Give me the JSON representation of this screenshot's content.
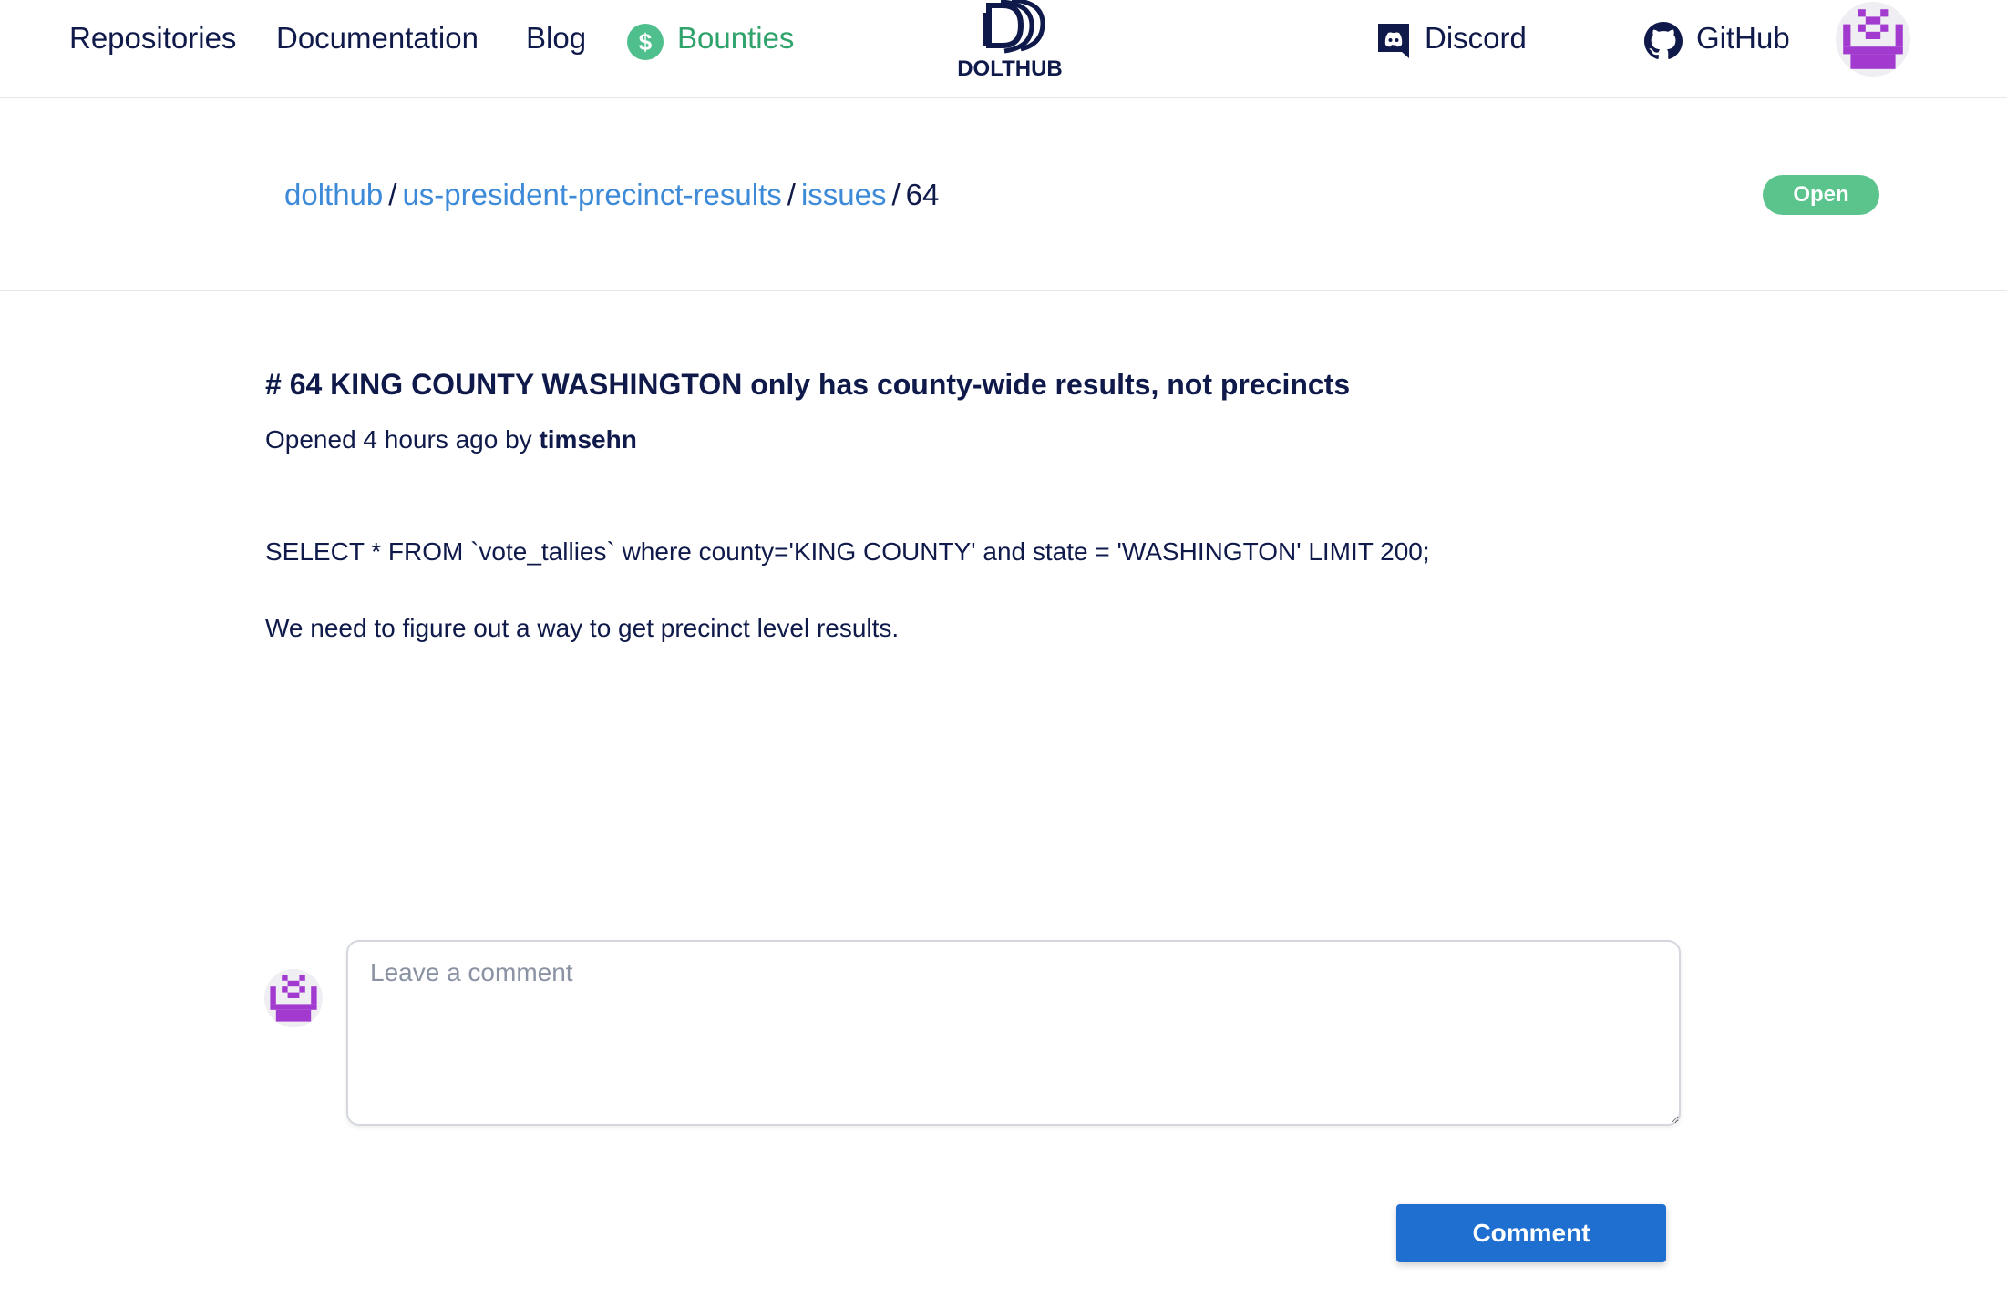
{
  "nav": {
    "repositories": "Repositories",
    "documentation": "Documentation",
    "blog": "Blog",
    "bounties": "Bounties",
    "bounty_symbol": "$",
    "logo_text": "DOLTHUB",
    "discord": "Discord",
    "github": "GitHub"
  },
  "breadcrumb": {
    "owner": "dolthub",
    "separator": "/",
    "repo": "us-president-precinct-results",
    "section": "issues",
    "current": "64"
  },
  "status": "Open",
  "issue": {
    "title": "# 64 KING COUNTY WASHINGTON only has county-wide results, not precincts",
    "opened_prefix": "Opened 4 hours ago by ",
    "author": "timsehn",
    "body": [
      "SELECT * FROM `vote_tallies` where county='KING COUNTY' and state = 'WASHINGTON' LIMIT 200;",
      "We need to figure out a way to get precinct level results."
    ]
  },
  "comment": {
    "placeholder": "Leave a comment",
    "button_label": "Comment"
  },
  "colors": {
    "navy": "#0f1a4a",
    "link_blue": "#3d8ad8",
    "bounty_green": "#2fa36b",
    "badge_green": "#5ac48c",
    "button_blue": "#1f6fd0",
    "avatar_purple": "#a23ad0"
  },
  "icons": [
    "dollar-icon",
    "dolthub-logo-icon",
    "discord-icon",
    "github-icon",
    "identicon-avatar"
  ]
}
